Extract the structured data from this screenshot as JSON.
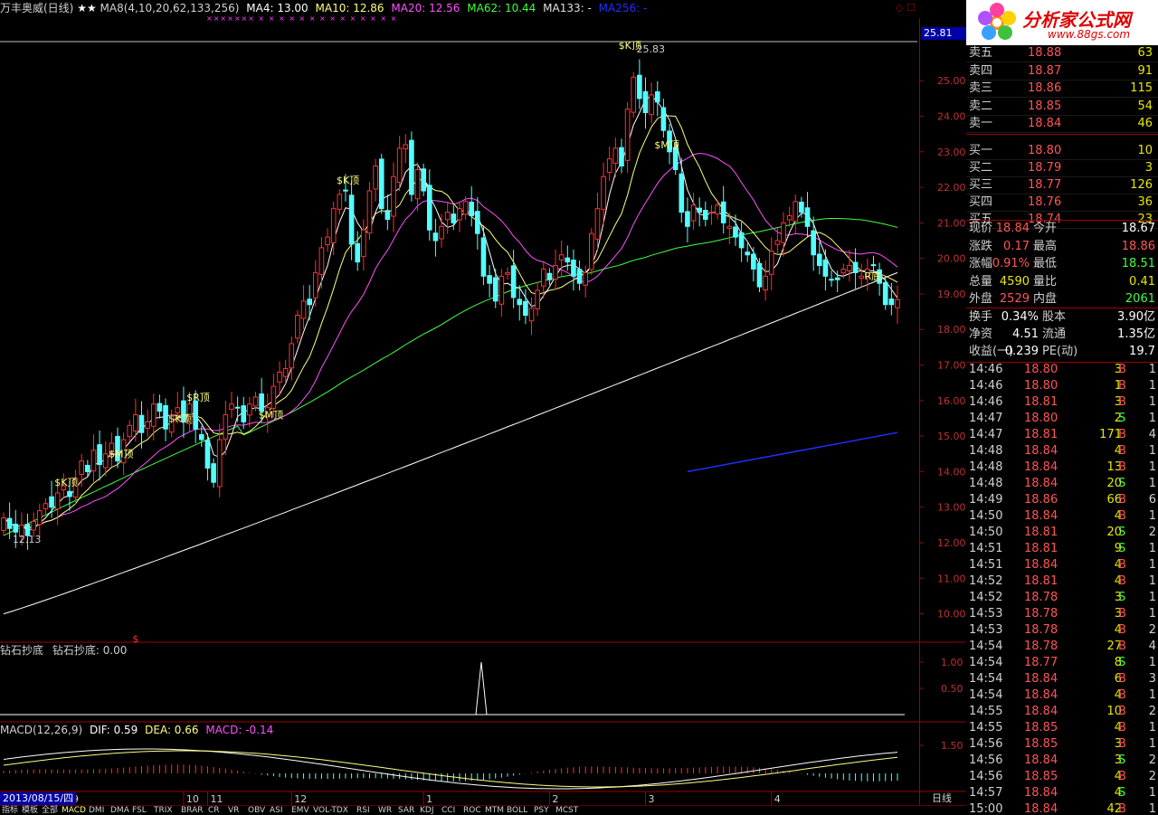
{
  "header": {
    "stock_name": "万丰奥威(日线)",
    "stars": "★★",
    "ma8": "MA8(4,10,20,62,133,256)",
    "ma4": "MA4: 13.00",
    "ma10": "MA10: 12.86",
    "ma20": "MA20: 12.56",
    "ma62": "MA62: 10.44",
    "ma133": "MA133: -",
    "ma256": "MA256: -",
    "top_flags": "××××××× ×  × × × × ×  × × × ×  ×  × × ×",
    "window_icons": "◇ ☐"
  },
  "logo": {
    "title": "分析家公式网",
    "url": "www.88gs.com"
  },
  "colors": {
    "up": "#ff3030",
    "down": "#54ffff",
    "ma4": "#ffffff",
    "ma10": "#ffff80",
    "ma20": "#ff50ff",
    "ma62": "#40ff40",
    "ma133": "#ffffff",
    "ma256": "#2030ff",
    "axis": "#a00000",
    "macd": "#ff50ff"
  },
  "price_axis": {
    "ticks": [
      "25.00",
      "24.00",
      "23.00",
      "22.00",
      "21.00",
      "20.00",
      "19.00",
      "18.00",
      "17.00",
      "16.00",
      "15.00",
      "14.00",
      "13.00",
      "12.00",
      "11.00",
      "10.00"
    ],
    "current_label": "25.81"
  },
  "annotations": [
    {
      "text": "$K顶",
      "price": 25.9,
      "bar": 104
    },
    {
      "text": "25.83",
      "price": 25.8,
      "bar": 107
    },
    {
      "text": "$K顶",
      "price": 22.1,
      "bar": 57
    },
    {
      "text": "$M顶",
      "price": 23.1,
      "bar": 110
    },
    {
      "text": "$R顶",
      "price": 16.0,
      "bar": 32
    },
    {
      "text": "$K顶",
      "price": 15.4,
      "bar": 29
    },
    {
      "text": "$M顶",
      "price": 15.5,
      "bar": 44
    },
    {
      "text": "$M顶",
      "price": 14.4,
      "bar": 19
    },
    {
      "text": "$K顶",
      "price": 13.6,
      "bar": 10
    },
    {
      "text": "12.13",
      "price": 12.0,
      "bar": 3
    },
    {
      "text": "R底",
      "price": 19.4,
      "bar": 145
    },
    {
      "text": "$",
      "price": 9.2,
      "bar": 23
    }
  ],
  "indicator": {
    "title": "钻石抄底",
    "value_label": "钻石抄底: 0.00",
    "ticks": [
      "1.00",
      "0.50"
    ]
  },
  "macd": {
    "title": "MACD(12,26,9)",
    "dif": "DIF: 0.59",
    "dea": "DEA: 0.66",
    "macd": "MACD: -0.14",
    "ticks": [
      "1.50"
    ]
  },
  "time_axis": {
    "date": "2013/08/15/四",
    "months": [
      {
        "label": "9",
        "bar": 11
      },
      {
        "label": "10",
        "bar": 30
      },
      {
        "label": "11",
        "bar": 34
      },
      {
        "label": "12",
        "bar": 48
      },
      {
        "label": "1",
        "bar": 70
      },
      {
        "label": "2",
        "bar": 91
      },
      {
        "label": "3",
        "bar": 107
      },
      {
        "label": "4",
        "bar": 128
      }
    ],
    "period": "日线"
  },
  "tabs": [
    "指标",
    "模板",
    "全部",
    "MACD",
    "DMI",
    "DMA",
    "FSL",
    "TRIX",
    "BRAR",
    "CR",
    "VR",
    "OBV",
    "ASI",
    "EMV",
    "VOL-TDX",
    "RSI",
    "WR",
    "SAR",
    "KDJ",
    "CCI",
    "ROC",
    "MTM",
    "BOLL",
    "PSY",
    "MCST"
  ],
  "quote": {
    "sells": [
      {
        "label": "卖五",
        "price": "18.88",
        "volume": "63"
      },
      {
        "label": "卖四",
        "price": "18.87",
        "volume": "91"
      },
      {
        "label": "卖三",
        "price": "18.86",
        "volume": "115"
      },
      {
        "label": "卖二",
        "price": "18.85",
        "volume": "54"
      },
      {
        "label": "卖一",
        "price": "18.84",
        "volume": "46"
      }
    ],
    "buys": [
      {
        "label": "买一",
        "price": "18.80",
        "volume": "10"
      },
      {
        "label": "买二",
        "price": "18.79",
        "volume": "3"
      },
      {
        "label": "买三",
        "price": "18.77",
        "volume": "126"
      },
      {
        "label": "买四",
        "price": "18.76",
        "volume": "36"
      },
      {
        "label": "买五",
        "price": "18.74",
        "volume": "23"
      }
    ]
  },
  "stats": [
    {
      "l1": "现价",
      "v1": "18.84",
      "c1": "#ff5555",
      "l2": "今开",
      "v2": "18.67",
      "c2": "#ffffff"
    },
    {
      "l1": "涨跌",
      "v1": "0.17",
      "c1": "#ff5555",
      "l2": "最高",
      "v2": "18.86",
      "c2": "#ff5555"
    },
    {
      "l1": "涨幅",
      "v1": "0.91%",
      "c1": "#ff5555",
      "l2": "最低",
      "v2": "18.51",
      "c2": "#40ff40"
    },
    {
      "l1": "总量",
      "v1": "4590",
      "c1": "#e8e800",
      "l2": "量比",
      "v2": "0.41",
      "c2": "#e8e800"
    },
    {
      "l1": "外盘",
      "v1": "2529",
      "c1": "#ff5555",
      "l2": "内盘",
      "v2": "2061",
      "c2": "#40ff40"
    }
  ],
  "stats2": [
    {
      "l1": "换手",
      "v1": "0.34%",
      "l2": "股本",
      "v2": "3.90亿"
    },
    {
      "l1": "净资",
      "v1": "4.51",
      "l2": "流通",
      "v2": "1.35亿"
    },
    {
      "l1": "收益(一)",
      "v1": "0.239",
      "l2": "PE(动)",
      "v2": "19.7"
    }
  ],
  "ticks": [
    {
      "time": "14:46",
      "price": "18.80",
      "vol": "3",
      "bs": "B",
      "n": "1"
    },
    {
      "time": "14:46",
      "price": "18.80",
      "vol": "1",
      "bs": "B",
      "n": "1"
    },
    {
      "time": "14:46",
      "price": "18.81",
      "vol": "3",
      "bs": "B",
      "n": "1"
    },
    {
      "time": "14:47",
      "price": "18.80",
      "vol": "2",
      "bs": "S",
      "n": "1"
    },
    {
      "time": "14:47",
      "price": "18.81",
      "vol": "171",
      "bs": "B",
      "n": "4"
    },
    {
      "time": "14:48",
      "price": "18.84",
      "vol": "4",
      "bs": "B",
      "n": "1"
    },
    {
      "time": "14:48",
      "price": "18.84",
      "vol": "13",
      "bs": "B",
      "n": "1"
    },
    {
      "time": "14:48",
      "price": "18.84",
      "vol": "20",
      "bs": "S",
      "n": "1"
    },
    {
      "time": "14:49",
      "price": "18.86",
      "vol": "66",
      "bs": "B",
      "n": "6"
    },
    {
      "time": "14:50",
      "price": "18.84",
      "vol": "4",
      "bs": "B",
      "n": "1"
    },
    {
      "time": "14:50",
      "price": "18.81",
      "vol": "20",
      "bs": "S",
      "n": "2"
    },
    {
      "time": "14:51",
      "price": "18.81",
      "vol": "9",
      "bs": "S",
      "n": "1"
    },
    {
      "time": "14:51",
      "price": "18.84",
      "vol": "4",
      "bs": "B",
      "n": "1"
    },
    {
      "time": "14:52",
      "price": "18.81",
      "vol": "4",
      "bs": "B",
      "n": "1"
    },
    {
      "time": "14:52",
      "price": "18.78",
      "vol": "3",
      "bs": "S",
      "n": "1"
    },
    {
      "time": "14:53",
      "price": "18.78",
      "vol": "3",
      "bs": "B",
      "n": "1"
    },
    {
      "time": "14:53",
      "price": "18.78",
      "vol": "4",
      "bs": "B",
      "n": "2"
    },
    {
      "time": "14:54",
      "price": "18.78",
      "vol": "27",
      "bs": "B",
      "n": "4"
    },
    {
      "time": "14:54",
      "price": "18.77",
      "vol": "8",
      "bs": "S",
      "n": "1"
    },
    {
      "time": "14:54",
      "price": "18.84",
      "vol": "6",
      "bs": "B",
      "n": "3"
    },
    {
      "time": "14:54",
      "price": "18.84",
      "vol": "4",
      "bs": "B",
      "n": "1"
    },
    {
      "time": "14:55",
      "price": "18.84",
      "vol": "10",
      "bs": "B",
      "n": "2"
    },
    {
      "time": "14:55",
      "price": "18.85",
      "vol": "4",
      "bs": "B",
      "n": "1"
    },
    {
      "time": "14:56",
      "price": "18.85",
      "vol": "3",
      "bs": "B",
      "n": "1"
    },
    {
      "time": "14:56",
      "price": "18.84",
      "vol": "3",
      "bs": "S",
      "n": "2"
    },
    {
      "time": "14:56",
      "price": "18.85",
      "vol": "4",
      "bs": "B",
      "n": "2"
    },
    {
      "time": "14:57",
      "price": "18.84",
      "vol": "4",
      "bs": "S",
      "n": "1"
    },
    {
      "time": "15:00",
      "price": "18.84",
      "vol": "42",
      "bs": "B",
      "n": "1"
    }
  ],
  "chart_data": {
    "type": "candlestick",
    "title": "万丰奥威(日线)",
    "ylim": [
      9.2,
      26.1
    ],
    "closes": [
      12.7,
      12.4,
      12.3,
      12.5,
      12.2,
      12.6,
      12.9,
      13.1,
      13.0,
      13.4,
      13.6,
      13.3,
      13.8,
      14.3,
      14.0,
      14.6,
      14.2,
      14.5,
      14.8,
      14.3,
      14.9,
      15.3,
      15.6,
      15.1,
      15.4,
      15.9,
      15.7,
      15.2,
      15.6,
      15.8,
      15.4,
      15.9,
      15.2,
      14.9,
      14.1,
      13.7,
      14.9,
      15.6,
      15.9,
      15.8,
      15.4,
      15.9,
      16.1,
      15.7,
      15.8,
      16.4,
      16.8,
      16.9,
      17.6,
      18.4,
      18.8,
      18.7,
      19.6,
      20.3,
      20.6,
      21.4,
      21.8,
      21.9,
      20.4,
      19.9,
      20.8,
      21.9,
      22.6,
      21.4,
      21.1,
      22.3,
      23.1,
      23.2,
      21.8,
      22.5,
      21.9,
      20.8,
      20.5,
      20.9,
      21.3,
      21.0,
      21.4,
      21.6,
      21.2,
      20.7,
      19.5,
      19.3,
      18.8,
      19.5,
      19.6,
      18.9,
      18.7,
      18.4,
      18.6,
      19.1,
      19.7,
      19.4,
      19.8,
      20.1,
      19.9,
      19.5,
      19.3,
      19.6,
      20.7,
      21.4,
      22.3,
      22.8,
      23.1,
      22.6,
      24.2,
      25.1,
      24.5,
      24.1,
      24.6,
      24.4,
      23.6,
      23.0,
      22.5,
      21.3,
      20.9,
      21.5,
      21.3,
      21.1,
      21.3,
      21.5,
      21.0,
      20.9,
      20.6,
      20.3,
      20.1,
      19.7,
      19.2,
      19.5,
      20.2,
      20.5,
      21.0,
      21.2,
      21.6,
      21.3,
      20.9,
      20.1,
      19.8,
      19.5,
      19.4,
      19.4,
      19.7,
      19.8,
      19.6,
      19.5,
      19.7,
      19.8,
      19.3,
      18.7,
      18.7,
      18.84
    ],
    "ma62_end": 21.1,
    "ma133_end": 19.6,
    "ma256": [
      14.0,
      15.1
    ],
    "indicator_series": "single spike to 1.00 near bar 98",
    "macd_values": {
      "dif": 0.59,
      "dea": 0.66,
      "macd": -0.14
    }
  }
}
